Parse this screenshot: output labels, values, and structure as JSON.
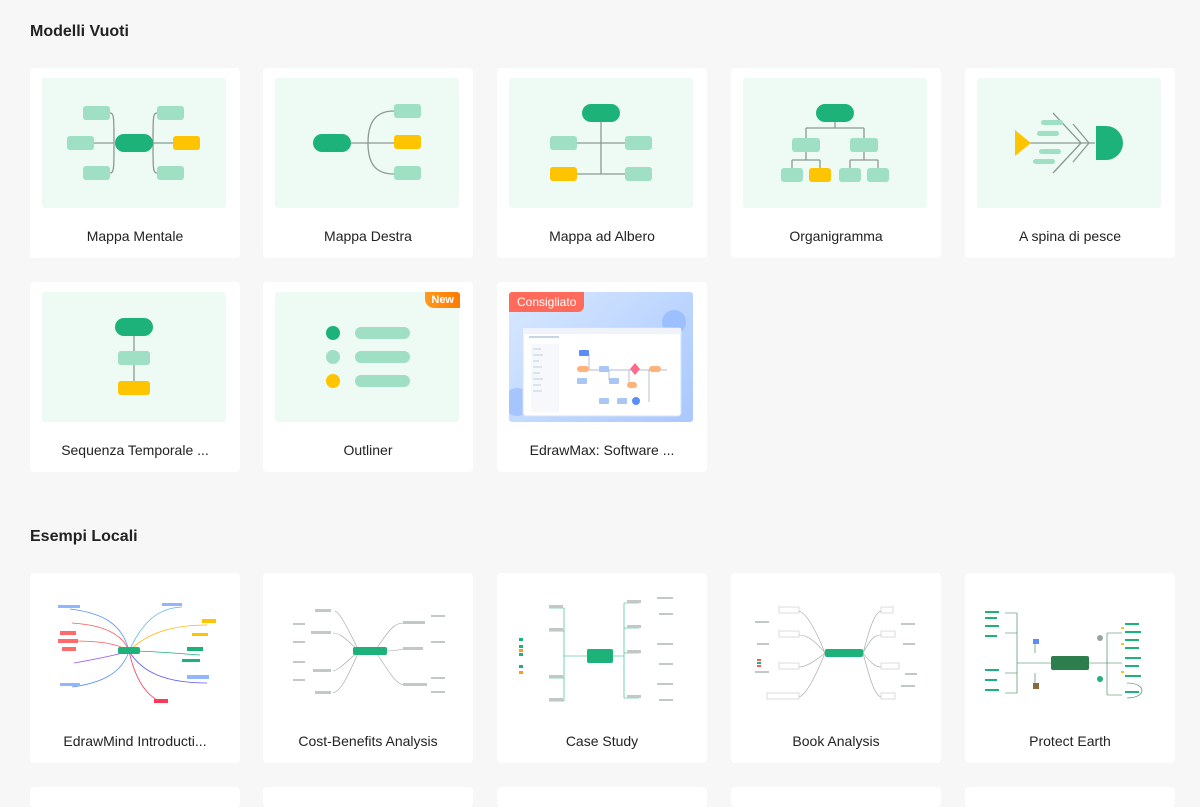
{
  "sections": {
    "blank": {
      "title": "Modelli Vuoti"
    },
    "local": {
      "title": "Esempi Locali"
    }
  },
  "blank_templates": [
    {
      "label": "Mappa Mentale"
    },
    {
      "label": "Mappa Destra"
    },
    {
      "label": "Mappa ad Albero"
    },
    {
      "label": "Organigramma"
    },
    {
      "label": "A spina di pesce"
    },
    {
      "label": "Sequenza Temporale ..."
    },
    {
      "label": "Outliner",
      "badge": "New"
    },
    {
      "label": "EdrawMax: Software ...",
      "badge": "Consigliato"
    }
  ],
  "local_examples": [
    {
      "label": "EdrawMind Introducti..."
    },
    {
      "label": "Cost-Benefits Analysis"
    },
    {
      "label": "Case Study"
    },
    {
      "label": "Book Analysis"
    },
    {
      "label": "Protect Earth"
    }
  ],
  "colors": {
    "green": "#1cb27a",
    "light_green": "#9fdfc4",
    "yellow": "#ffc400",
    "badge_new": "#ff8a00",
    "badge_recommended": "#ff6a5a",
    "thumb_bg": "#eefaf4"
  }
}
